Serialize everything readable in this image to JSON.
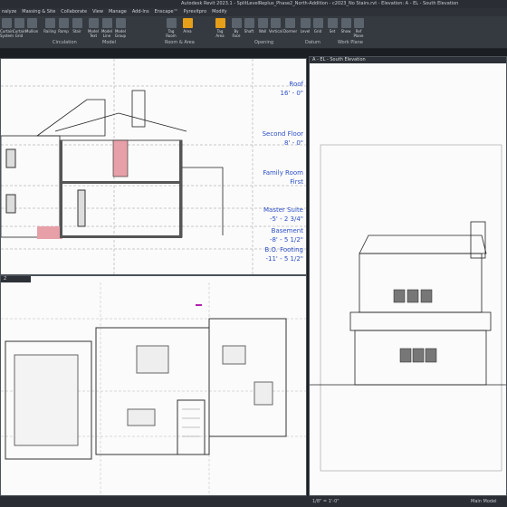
{
  "window": {
    "title": "Autodesk Revit 2023.1 - SplitLevelReplus_Phase2_North-Addition - c2023_No Stairs.rvt - Elevation: A - EL - South Elevation"
  },
  "ribbon_tabs": [
    "nalyze",
    "Massing & Site",
    "Collaborate",
    "View",
    "Manage",
    "Add-Ins",
    "Enscape™",
    "Pyrevitpro",
    "Modify"
  ],
  "ribbon_tools": [
    {
      "label": "Curtain System",
      "icon": "curtain-system-icon"
    },
    {
      "label": "Curtain Grid",
      "icon": "curtain-grid-icon"
    },
    {
      "label": "Mullion",
      "icon": "mullion-icon"
    },
    {
      "label": "Railing",
      "icon": "railing-icon"
    },
    {
      "label": "Ramp",
      "icon": "ramp-icon"
    },
    {
      "label": "Stair",
      "icon": "stair-icon"
    },
    {
      "label": "Model Text",
      "icon": "model-text-icon"
    },
    {
      "label": "Model Line",
      "icon": "model-line-icon"
    },
    {
      "label": "Model Group",
      "icon": "model-group-icon"
    },
    {
      "label": "Tag Room",
      "icon": "tag-room-icon"
    },
    {
      "label": "Area",
      "icon": "area-icon"
    },
    {
      "label": "Tag Area",
      "icon": "tag-area-icon"
    },
    {
      "label": "By Face",
      "icon": "by-face-icon"
    },
    {
      "label": "Shaft",
      "icon": "shaft-icon"
    },
    {
      "label": "Wall",
      "icon": "wall-opening-icon"
    },
    {
      "label": "Vertical",
      "icon": "vertical-opening-icon"
    },
    {
      "label": "Dormer",
      "icon": "dormer-icon"
    },
    {
      "label": "Level",
      "icon": "level-icon"
    },
    {
      "label": "Grid",
      "icon": "grid-icon"
    },
    {
      "label": "Set",
      "icon": "set-icon"
    },
    {
      "label": "Show",
      "icon": "show-icon"
    },
    {
      "label": "Ref Plane",
      "icon": "ref-plane-icon"
    }
  ],
  "ribbon_groups": [
    "Circulation",
    "Model",
    "Room & Area",
    "Opening",
    "Datum",
    "Work Plane"
  ],
  "views": {
    "section_levels": [
      {
        "name": "Roof",
        "elev": "16' - 0\""
      },
      {
        "name": "Second Floor",
        "elev": "8' - 0\""
      },
      {
        "name": "Family Room",
        "elev": "First"
      },
      {
        "name": "Master Suite",
        "elev": "-5' - 2 3/4\""
      },
      {
        "name": "Basement",
        "elev": "-8' - 5 1/2\""
      },
      {
        "name": "B.O. Footing",
        "elev": "-11' - 5 1/2\""
      }
    ],
    "plan_tab": "2",
    "elevation_tab": "A - EL - South Elevation"
  },
  "status": {
    "scale": "1/8\" = 1'-0\"",
    "model": "Main Model"
  },
  "colors": {
    "accent": "#e59f18",
    "hatch": "#e7a0a8",
    "sel": "#b020b0"
  }
}
